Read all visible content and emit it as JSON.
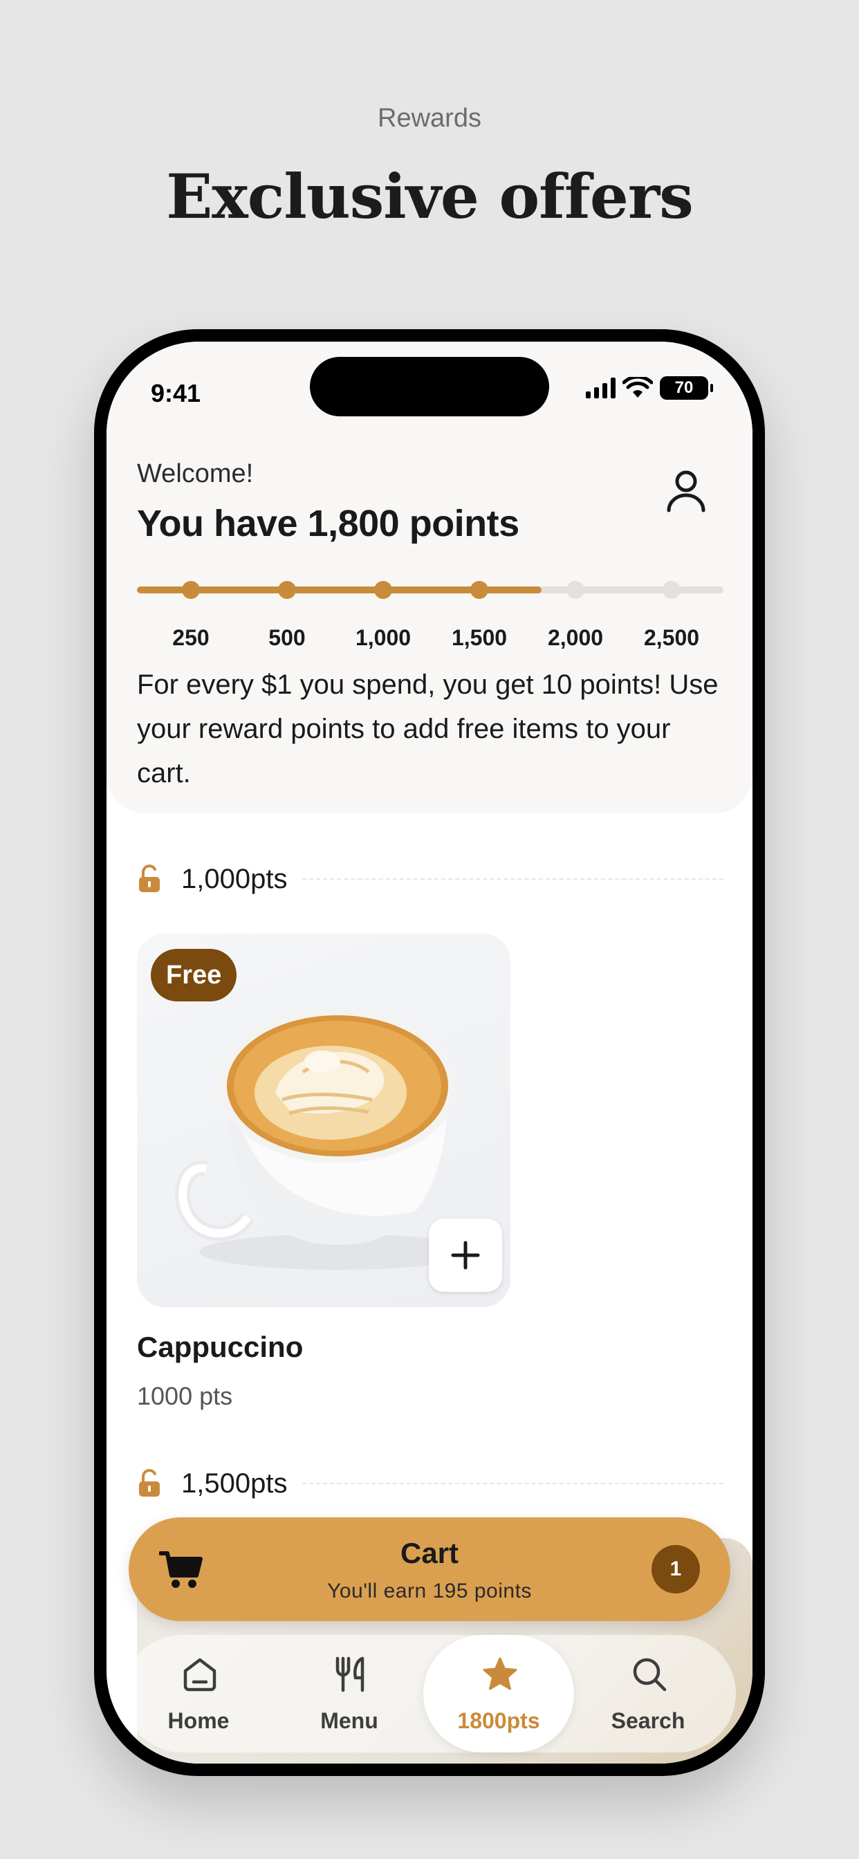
{
  "header": {
    "kicker": "Rewards",
    "title": "Exclusive offers"
  },
  "status_bar": {
    "time": "9:41",
    "battery": "70"
  },
  "rewards": {
    "welcome": "Welcome!",
    "points_title": "You have 1,800 points",
    "progress_fraction": 0.69,
    "milestones": [
      "250",
      "500",
      "1,000",
      "1,500",
      "2,000",
      "2,500"
    ],
    "milestones_reached": 4,
    "info": "For every $1 you spend, you get 10 points! Use your reward points to add free items to your cart."
  },
  "tiers": [
    {
      "label": "1,000pts"
    },
    {
      "label": "1,500pts"
    }
  ],
  "product": {
    "badge": "Free",
    "name": "Cappuccino",
    "price": "1000 pts"
  },
  "cart": {
    "title": "Cart",
    "subtitle": "You'll earn 195 points",
    "count": "1"
  },
  "tabbar": {
    "items": [
      {
        "label": "Home",
        "icon": "home-icon"
      },
      {
        "label": "Menu",
        "icon": "utensils-icon"
      },
      {
        "label": "1800pts",
        "icon": "star-icon",
        "active": true
      },
      {
        "label": "Search",
        "icon": "search-icon"
      }
    ]
  },
  "colors": {
    "accent": "#c98b3b",
    "cart_bar": "#daa050",
    "badge": "#7a4a0f",
    "background": "#e6e6e7"
  }
}
